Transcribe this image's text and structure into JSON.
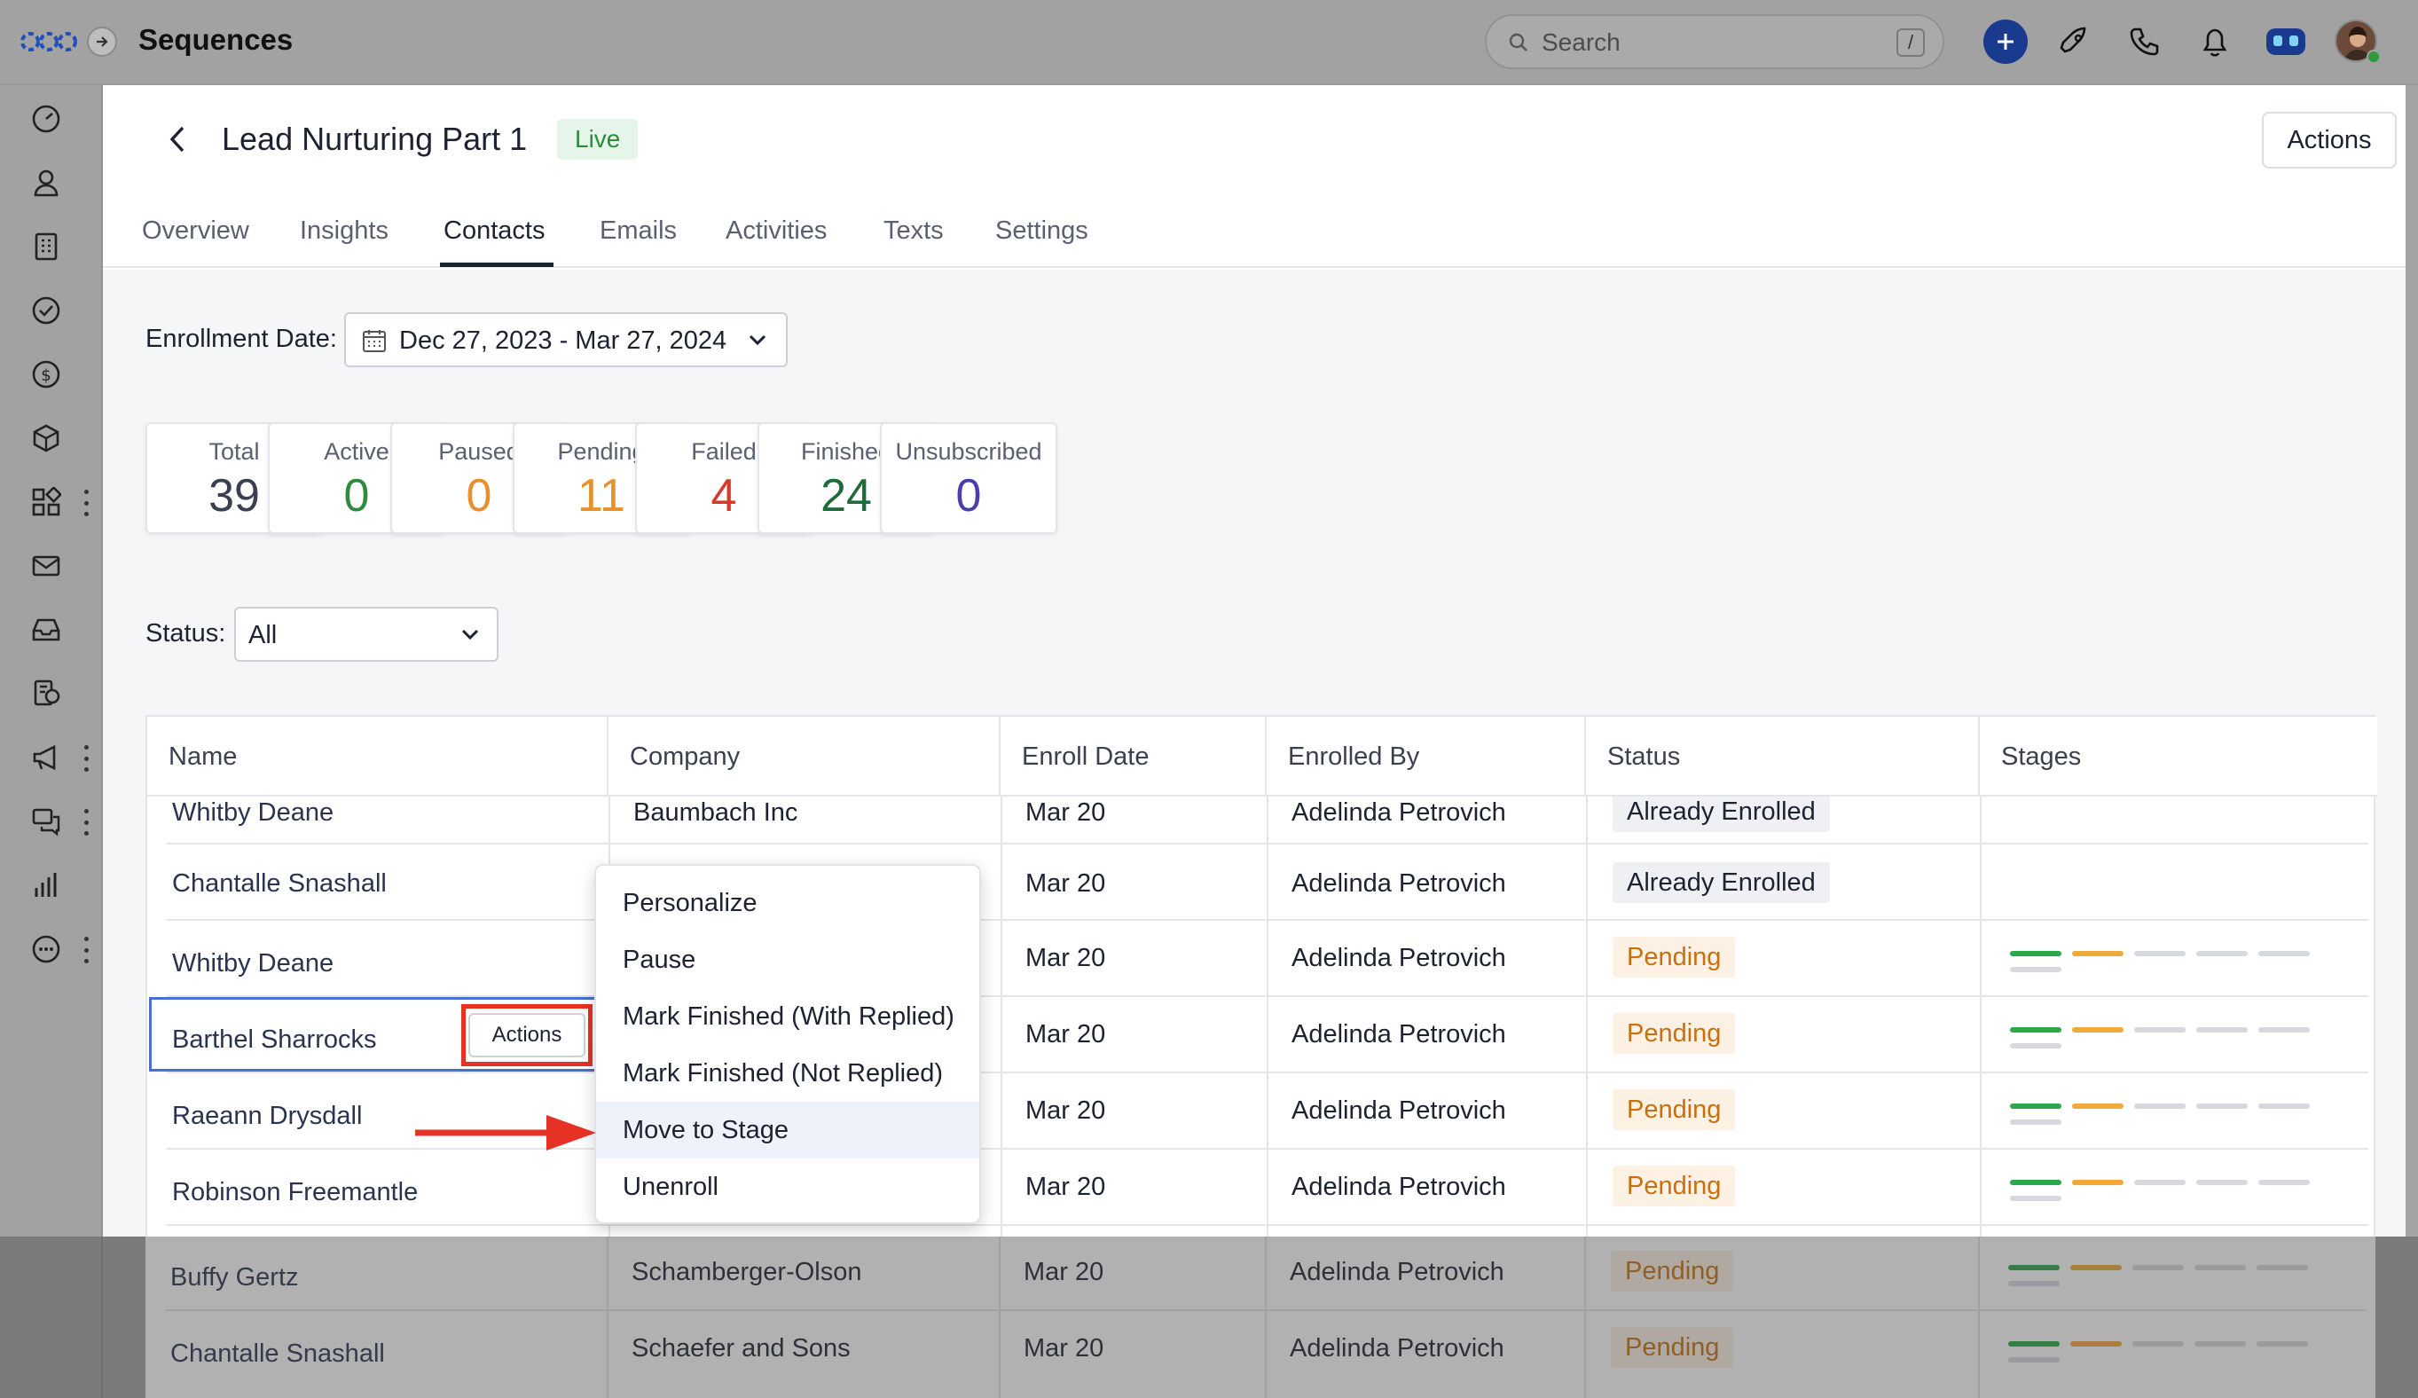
{
  "app": {
    "title": "Sequences",
    "search_placeholder": "Search",
    "search_shortcut": "/"
  },
  "sequence": {
    "name": "Lead Nurturing Part 1",
    "status_badge": "Live",
    "actions_label": "Actions"
  },
  "tabs": [
    {
      "label": "Overview",
      "active": false
    },
    {
      "label": "Insights",
      "active": false
    },
    {
      "label": "Contacts",
      "active": true
    },
    {
      "label": "Emails",
      "active": false
    },
    {
      "label": "Activities",
      "active": false
    },
    {
      "label": "Texts",
      "active": false
    },
    {
      "label": "Settings",
      "active": false
    }
  ],
  "filters": {
    "enrollment_label": "Enrollment Date:",
    "enrollment_range": "Dec 27, 2023 - Mar 27, 2024",
    "status_label": "Status:",
    "status_value": "All"
  },
  "stats": [
    {
      "label": "Total",
      "value": "39",
      "color": "#3a4050"
    },
    {
      "label": "Active",
      "value": "0",
      "color": "#2e8a3c"
    },
    {
      "label": "Paused",
      "value": "0",
      "color": "#e8902a"
    },
    {
      "label": "Pending",
      "value": "11",
      "color": "#e8902a"
    },
    {
      "label": "Failed",
      "value": "4",
      "color": "#d83a2a"
    },
    {
      "label": "Finished",
      "value": "24",
      "color": "#1f6b3a"
    },
    {
      "label": "Unsubscribed",
      "value": "0",
      "color": "#4a3fa8"
    }
  ],
  "table": {
    "columns": [
      "Name",
      "Company",
      "Enroll Date",
      "Enrolled By",
      "Status",
      "Stages"
    ],
    "rows": [
      {
        "name": "Whitby Deane",
        "company": "Baumbach Inc",
        "enroll_date": "Mar 20",
        "enrolled_by": "Adelinda Petrovich",
        "status": "Already Enrolled"
      },
      {
        "name": "Chantalle Snashall",
        "company": "",
        "enroll_date": "Mar 20",
        "enrolled_by": "Adelinda Petrovich",
        "status": "Already Enrolled"
      },
      {
        "name": "Whitby Deane",
        "company": "",
        "enroll_date": "Mar 20",
        "enrolled_by": "Adelinda Petrovich",
        "status": "Pending"
      },
      {
        "name": "Barthel Sharrocks",
        "company": "",
        "enroll_date": "Mar 20",
        "enrolled_by": "Adelinda Petrovich",
        "status": "Pending"
      },
      {
        "name": "Raeann Drysdall",
        "company": "",
        "enroll_date": "Mar 20",
        "enrolled_by": "Adelinda Petrovich",
        "status": "Pending"
      },
      {
        "name": "Robinson Freemantle",
        "company": "",
        "enroll_date": "Mar 20",
        "enrolled_by": "Adelinda Petrovich",
        "status": "Pending"
      },
      {
        "name": "Buffy Gertz",
        "company": "Schamberger-Olson",
        "enroll_date": "Mar 20",
        "enrolled_by": "Adelinda Petrovich",
        "status": "Pending"
      },
      {
        "name": "Chantalle Snashall",
        "company": "Schaefer and Sons",
        "enroll_date": "Mar 20",
        "enrolled_by": "Adelinda Petrovich",
        "status": "Pending"
      }
    ],
    "row_actions_label": "Actions"
  },
  "row_menu": {
    "items": [
      "Personalize",
      "Pause",
      "Mark Finished (With Replied)",
      "Mark Finished (Not Replied)",
      "Move to Stage",
      "Unenroll"
    ],
    "hovered": "Move to Stage"
  },
  "colors": {
    "stage_done": "#2aa84a",
    "stage_current": "#f2a93b",
    "stage_todo": "#d6d9de",
    "annotation": "#e53224",
    "selection": "#4a6fd4"
  }
}
